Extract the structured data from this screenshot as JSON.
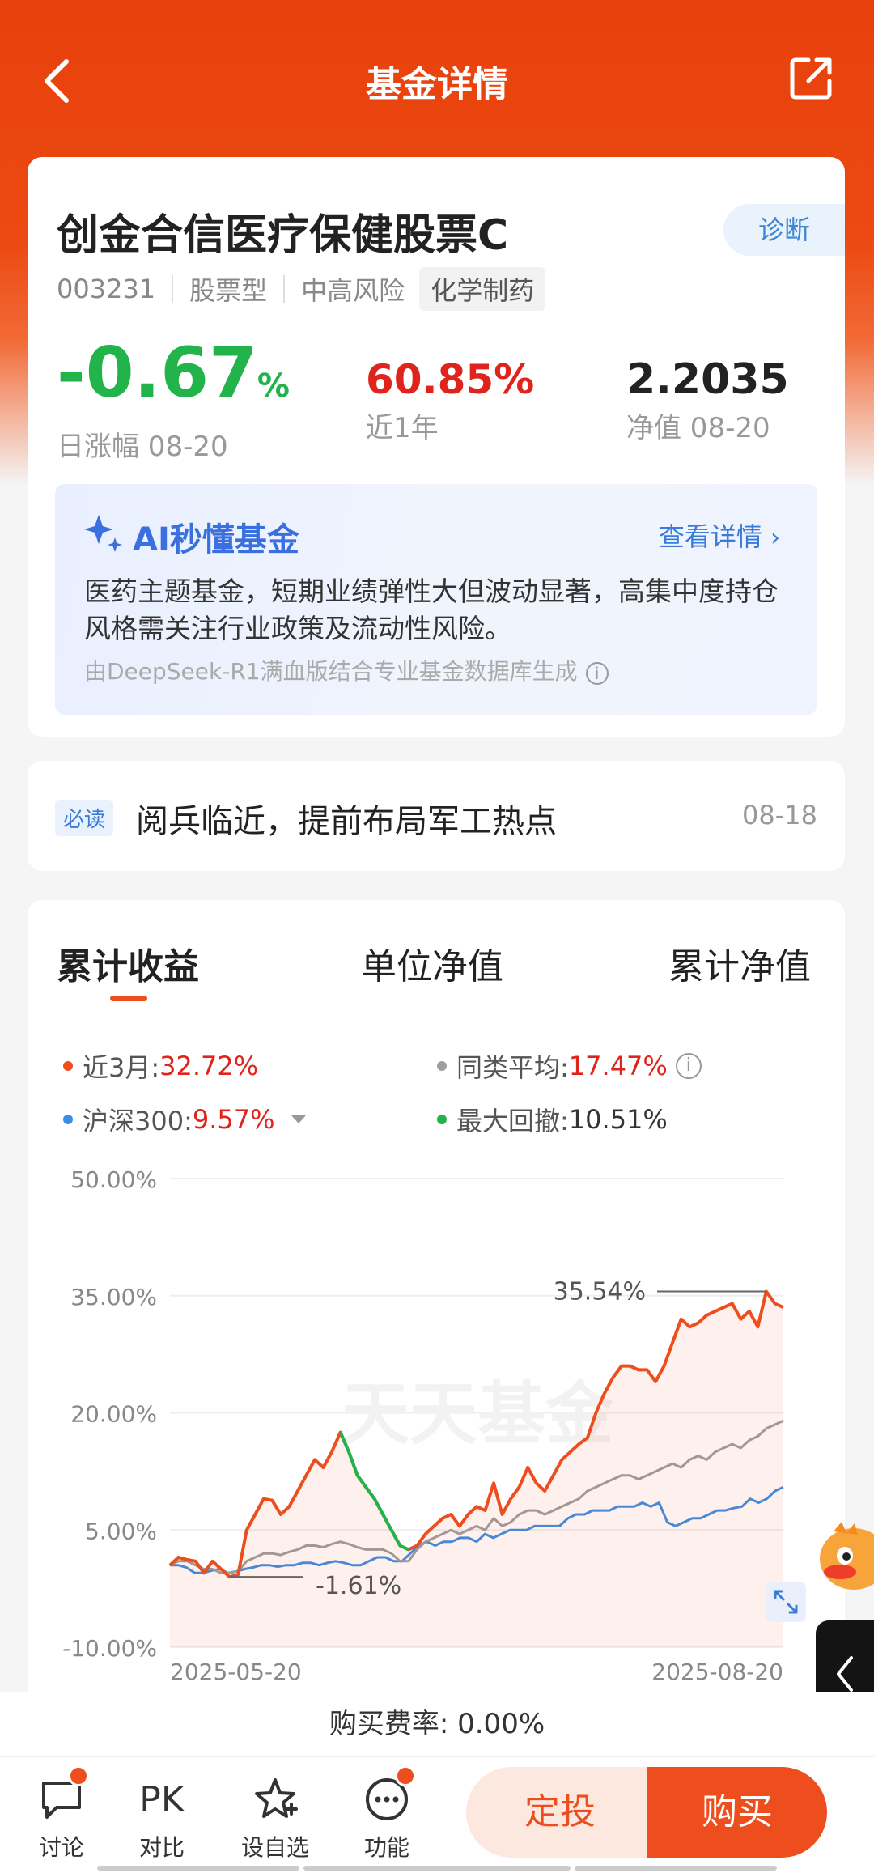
{
  "header": {
    "title": "基金详情"
  },
  "fund": {
    "name": "创金合信医疗保健股票C",
    "diagnose": "诊断",
    "code": "003231",
    "type": "股票型",
    "risk": "中高风险",
    "sector": "化学制药",
    "stats": {
      "daily_change_value": "-0.67",
      "daily_change_unit": "%",
      "daily_change_label": "日涨幅 08-20",
      "year_return_value": "60.85%",
      "year_return_label": "近1年",
      "nav_value": "2.2035",
      "nav_label": "净值 08-20"
    }
  },
  "ai": {
    "title": "AI秒懂基金",
    "link": "查看详情",
    "text": "医药主题基金，短期业绩弹性大但波动显著，高集中度持仓风格需关注行业政策及流动性风险。",
    "footer": "由DeepSeek-R1满血版结合专业基金数据库生成"
  },
  "news": {
    "tag": "必读",
    "title": "阅兵临近，提前布局军工热点",
    "date": "08-18"
  },
  "chart_tabs": [
    "累计收益",
    "单位净值",
    "累计净值"
  ],
  "legend": {
    "fund_label": "近3月:",
    "fund_value": "32.72%",
    "avg_label": "同类平均:",
    "avg_value": "17.47%",
    "index_label": "沪深300:",
    "index_value": "9.57%",
    "drawdown_label": "最大回撤:",
    "drawdown_value": "10.51%"
  },
  "colors": {
    "fund": "#ee4d1d",
    "avg": "#9e9e9e",
    "index": "#3a8ee6",
    "drawdown": "#22b34a",
    "accent": "#ee4d1d"
  },
  "chart_data": {
    "type": "line",
    "ylim": [
      -10,
      50
    ],
    "yticks": [
      "50.00%",
      "35.00%",
      "20.00%",
      "5.00%",
      "-10.00%"
    ],
    "x_start": "2025-05-20",
    "x_end": "2025-08-20",
    "watermark": "天天基金",
    "max_label": "35.54%",
    "min_label": "-1.61%",
    "series": [
      {
        "key": "fund",
        "values": [
          0.5,
          1.5,
          1.2,
          1.0,
          -0.5,
          1.0,
          0,
          -1.0,
          -0.7,
          5.0,
          7.0,
          9.0,
          8.8,
          7.0,
          8.0,
          10.0,
          12.0,
          14.0,
          13.0,
          15.0,
          17.5,
          15.0,
          12.0,
          10.5,
          9.0,
          7.0,
          5.0,
          3.0,
          2.5,
          3.0,
          4.5,
          5.5,
          6.5,
          7.0,
          5.5,
          7.0,
          8.0,
          7.5,
          11.0,
          7.0,
          9.0,
          10.5,
          13.0,
          11.0,
          10.0,
          12.0,
          14.0,
          15.0,
          16.0,
          16.8,
          20.0,
          22.5,
          24.5,
          26.0,
          26.0,
          25.5,
          25.5,
          24.0,
          26.0,
          29.0,
          32.0,
          31.0,
          31.5,
          32.5,
          33.0,
          33.5,
          34.0,
          32.0,
          33.0,
          31.0,
          35.54,
          34.0,
          33.5
        ]
      },
      {
        "key": "avg",
        "values": [
          0.5,
          1.0,
          1.0,
          0.5,
          0,
          0,
          -0.5,
          -0.5,
          -0.3,
          1.0,
          1.5,
          2.0,
          2.0,
          1.8,
          2.2,
          2.5,
          3.0,
          3.0,
          2.8,
          3.2,
          3.5,
          3.2,
          2.8,
          2.5,
          2.5,
          2.5,
          2.0,
          1.0,
          1.0,
          2.5,
          3.5,
          4.0,
          4.5,
          5.0,
          4.5,
          5.0,
          5.5,
          5.0,
          6.5,
          5.5,
          6.0,
          7.0,
          7.5,
          7.5,
          7.0,
          7.5,
          8.0,
          8.5,
          9.0,
          10.0,
          10.5,
          11.0,
          11.5,
          12.0,
          12.0,
          11.5,
          12.0,
          12.5,
          13.0,
          13.5,
          13.0,
          14.0,
          14.5,
          14.0,
          15.0,
          15.5,
          16.0,
          15.5,
          16.5,
          17.0,
          18.0,
          18.5,
          19.0
        ]
      },
      {
        "key": "index",
        "values": [
          0.5,
          0.5,
          0.2,
          -0.5,
          -0.5,
          -0.2,
          0,
          -0.5,
          -0.3,
          0,
          0.2,
          0.5,
          0.5,
          0.3,
          0.5,
          0.5,
          0.8,
          0.8,
          0.5,
          0.8,
          1.0,
          0.8,
          0.5,
          0.5,
          1.0,
          1.5,
          1.5,
          1.0,
          1.0,
          2.0,
          3.0,
          3.5,
          3.0,
          3.5,
          3.5,
          4.0,
          4.0,
          3.5,
          4.5,
          4.0,
          4.5,
          5.0,
          5.0,
          5.0,
          5.5,
          5.5,
          5.5,
          5.5,
          6.5,
          7.0,
          7.0,
          7.5,
          7.5,
          7.5,
          8.0,
          8.0,
          8.0,
          8.5,
          8.0,
          8.5,
          6.0,
          5.5,
          6.0,
          6.5,
          6.5,
          7.0,
          7.5,
          7.5,
          7.8,
          8.0,
          9.0,
          8.5,
          9.0,
          10.0,
          10.5
        ]
      }
    ]
  },
  "fee": "购买费率: 0.00%",
  "bottom_nav": {
    "discuss": "讨论",
    "compare_icon": "PK",
    "compare": "对比",
    "favorite": "设自选",
    "more": "功能",
    "dingtou": "定投",
    "buy": "购买"
  }
}
